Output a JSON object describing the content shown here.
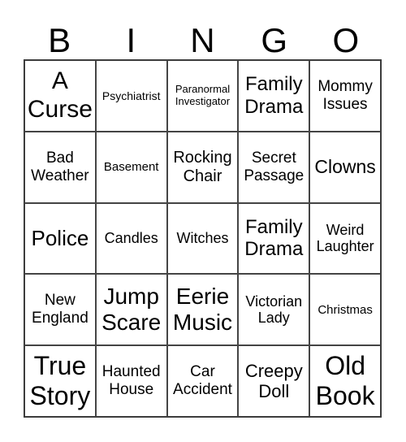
{
  "header": [
    "B",
    "I",
    "N",
    "G",
    "O"
  ],
  "cells": [
    "A Curse",
    "Psychiatrist",
    "Paranormal Investigator",
    "Family Drama",
    "Mommy Issues",
    "Bad Weather",
    "Basement",
    "Rocking Chair",
    "Secret Passage",
    "Clowns",
    "Police",
    "Candles",
    "Witches",
    "Family Drama",
    "Weird Laughter",
    "New England",
    "Jump Scare",
    "Eerie Music",
    "Victorian Lady",
    "Christmas",
    "True Story",
    "Haunted House",
    "Car Accident",
    "Creepy Doll",
    "Old Book"
  ]
}
